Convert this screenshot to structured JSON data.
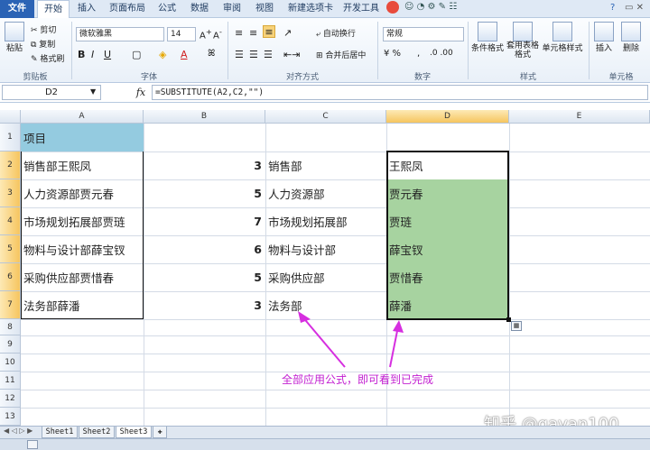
{
  "ribbon_tabs": [
    "文件",
    "开始",
    "插入",
    "页面布局",
    "公式",
    "数据",
    "审阅",
    "视图",
    "新建选项卡",
    "开发工具"
  ],
  "clipboard": {
    "paste": "粘贴",
    "cut": "剪切",
    "copy": "复制",
    "format_painter": "格式刷",
    "group": "剪贴板"
  },
  "font": {
    "name": "微软雅黑",
    "size": "14",
    "group": "字体"
  },
  "alignment": {
    "wrap": "自动换行",
    "merge": "合并后居中",
    "group": "对齐方式"
  },
  "number": {
    "format": "常规",
    "group": "数字"
  },
  "styles": {
    "conditional": "条件格式",
    "table": "套用表格格式",
    "cell": "单元格样式",
    "group": "样式"
  },
  "cells": {
    "insert": "插入",
    "delete": "删除",
    "group": "单元格"
  },
  "formula_bar": {
    "name_box": "D2",
    "fx": "fx",
    "formula": "=SUBSTITUTE(A2,C2,\"\")"
  },
  "columns": [
    "A",
    "B",
    "C",
    "D",
    "E"
  ],
  "rows": [
    "1",
    "2",
    "3",
    "4",
    "5",
    "6",
    "7",
    "8",
    "9",
    "10",
    "11",
    "12",
    "13"
  ],
  "table": {
    "header": "项目",
    "rows": [
      {
        "a": "销售部王熙凤",
        "b": "3",
        "c": "销售部",
        "d": "王熙凤"
      },
      {
        "a": "人力资源部贾元春",
        "b": "5",
        "c": "人力资源部",
        "d": "贾元春"
      },
      {
        "a": "市场规划拓展部贾琏",
        "b": "7",
        "c": "市场规划拓展部",
        "d": "贾琏"
      },
      {
        "a": "物料与设计部薛宝钗",
        "b": "6",
        "c": "物料与设计部",
        "d": "薛宝钗"
      },
      {
        "a": "采购供应部贾惜春",
        "b": "5",
        "c": "采购供应部",
        "d": "贾惜春"
      },
      {
        "a": "法务部薛潘",
        "b": "3",
        "c": "法务部",
        "d": "薛潘"
      }
    ]
  },
  "annotation": "全部应用公式，即可看到已完成",
  "watermark": "知乎 @gavan100",
  "sheets": [
    "Sheet1",
    "Sheet2",
    "Sheet3"
  ],
  "colors": {
    "green_fill": "#a7d3a0",
    "header_fill": "#94cbe0",
    "annotation": "#c21fd1",
    "file_tab": "#2b63b5"
  }
}
